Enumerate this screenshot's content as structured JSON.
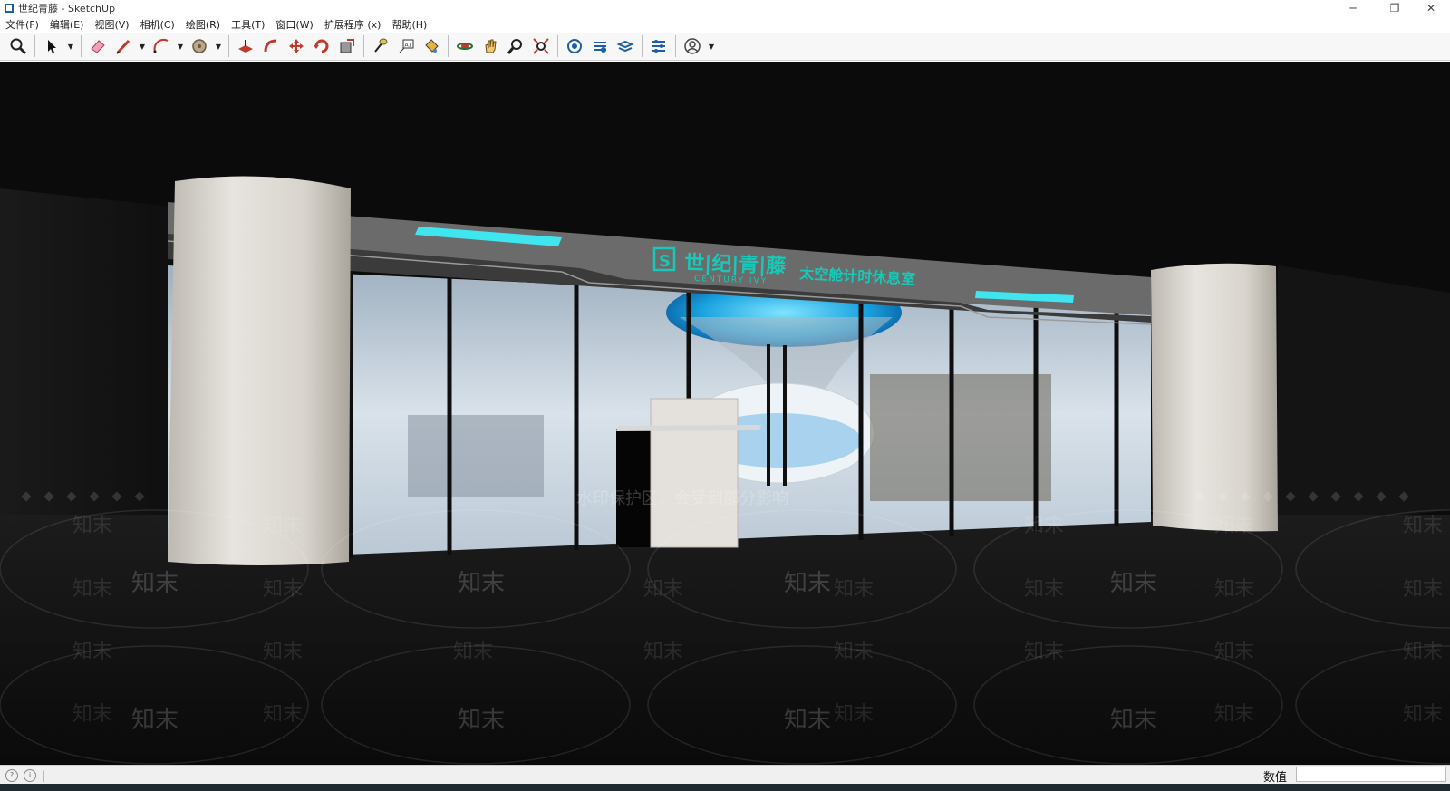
{
  "window": {
    "title": "世纪青藤 - SketchUp",
    "controls": {
      "minimize": "─",
      "restore": "❐",
      "close": "✕"
    }
  },
  "menu": [
    "文件(F)",
    "编辑(E)",
    "视图(V)",
    "相机(C)",
    "绘图(R)",
    "工具(T)",
    "窗口(W)",
    "扩展程序 (x)",
    "帮助(H)"
  ],
  "toolbar": {
    "tools": [
      "zoom-icon",
      "select-icon",
      "eraser-icon",
      "pencil-icon",
      "arc-icon",
      "circle-icon",
      "push-pull-icon",
      "follow-me-icon",
      "move-icon",
      "rotate-icon",
      "scale-icon",
      "tape-measure-icon",
      "text-icon",
      "paint-bucket-icon",
      "orbit-icon",
      "pan-icon",
      "zoom-window-icon",
      "zoom-extents-icon",
      "warehouse-icon",
      "extension-warehouse-icon",
      "layout-icon",
      "extension-manager-icon",
      "account-icon"
    ]
  },
  "scene": {
    "sign_logo_letter": "S",
    "sign_brand": "世|纪|青|藤",
    "sign_brand_en": "CENTURY IVY",
    "sign_subtitle": "太空舱计时休息室",
    "watermark_notice": "水印保护区，会受到部分影响",
    "watermark_brand": "知末",
    "colors": {
      "background": "#0b0b0b",
      "accent_cyan": "#3fe6ef",
      "sign_band": "#6b6b6b",
      "pillar": "#d9d6d0",
      "glass_interior": "#c7d3de"
    }
  },
  "status": {
    "measurements_label": "数值",
    "measurements_value": ""
  }
}
